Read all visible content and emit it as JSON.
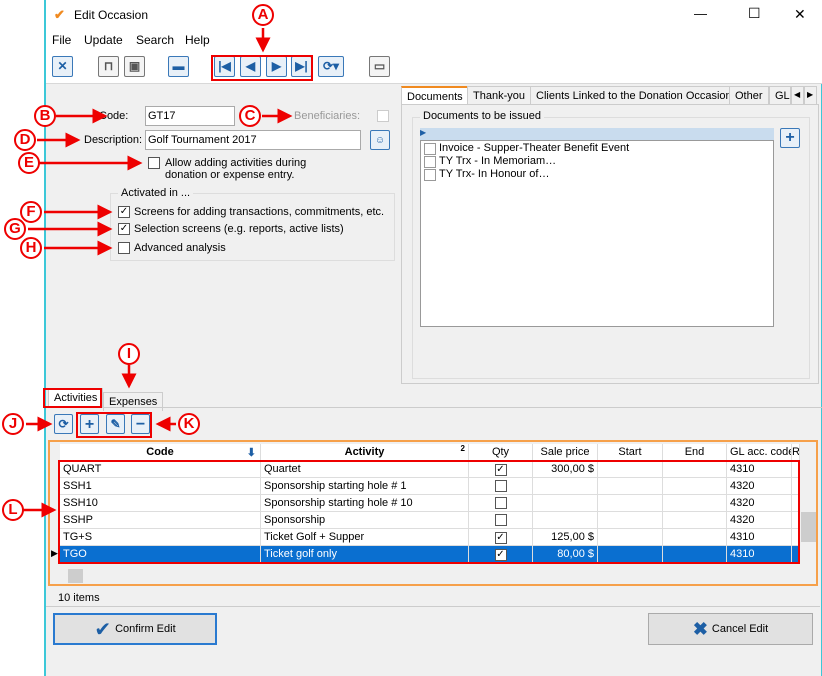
{
  "window": {
    "title": "Edit Occasion",
    "minimize": "—",
    "maximize": "☐",
    "close": "✕"
  },
  "menu": [
    "File",
    "Update",
    "Search",
    "Help"
  ],
  "form": {
    "code_label": "Code:",
    "code_value": "GT17",
    "beneficiaries_label": "Beneficiaries:",
    "beneficiaries_checked": false,
    "description_label": "Description:",
    "description_value": "Golf Tournament 2017",
    "allow_label_1": "Allow adding activities during",
    "allow_label_2": "donation or expense entry.",
    "allow_checked": false,
    "activated_group": "Activated in ...",
    "activated": [
      {
        "label": "Screens for adding transactions, commitments, etc.",
        "checked": true
      },
      {
        "label": "Selection screens (e.g. reports, active lists)",
        "checked": true
      },
      {
        "label": "Advanced analysis",
        "checked": false
      }
    ]
  },
  "right_tabs": [
    "Documents",
    "Thank-you",
    "Clients Linked to the Donation Occasion",
    "Other",
    "GL"
  ],
  "documents": {
    "group": "Documents to be issued",
    "items": [
      "Invoice - Supper-Theater Benefit Event",
      "TY Trx - In Memoriam…",
      "TY Trx- In Honour of…"
    ]
  },
  "bottom_tabs": [
    "Activities",
    "Expenses"
  ],
  "grid": {
    "columns": [
      "Code",
      "Activity",
      "Qty",
      "Sale price",
      "Start",
      "End",
      "GL acc. code",
      "R"
    ],
    "activity_badge": "2",
    "rows": [
      {
        "code": "QUART",
        "activity": "Quartet",
        "qty": true,
        "price": "300,00 $",
        "start": "",
        "end": "",
        "gl": "4310"
      },
      {
        "code": "SSH1",
        "activity": "Sponsorship starting hole # 1",
        "qty": false,
        "price": "",
        "start": "",
        "end": "",
        "gl": "4320"
      },
      {
        "code": "SSH10",
        "activity": "Sponsorship starting hole # 10",
        "qty": false,
        "price": "",
        "start": "",
        "end": "",
        "gl": "4320"
      },
      {
        "code": "SSHP",
        "activity": "Sponsorship",
        "qty": false,
        "price": "",
        "start": "",
        "end": "",
        "gl": "4320"
      },
      {
        "code": "TG+S",
        "activity": "Ticket Golf + Supper",
        "qty": true,
        "price": "125,00 $",
        "start": "",
        "end": "",
        "gl": "4310"
      },
      {
        "code": "TGO",
        "activity": "Ticket golf only",
        "qty": true,
        "price": "80,00 $",
        "start": "",
        "end": "",
        "gl": "4310",
        "selected": true
      }
    ]
  },
  "status": "10 items",
  "buttons": {
    "confirm": "Confirm Edit",
    "cancel": "Cancel Edit"
  },
  "annotations": [
    "A",
    "B",
    "C",
    "D",
    "E",
    "F",
    "G",
    "H",
    "I",
    "J",
    "K",
    "L"
  ],
  "colors": {
    "accent": "#0a6fd0",
    "annotation": "#e00000",
    "tab_accent": "#f08a20"
  }
}
